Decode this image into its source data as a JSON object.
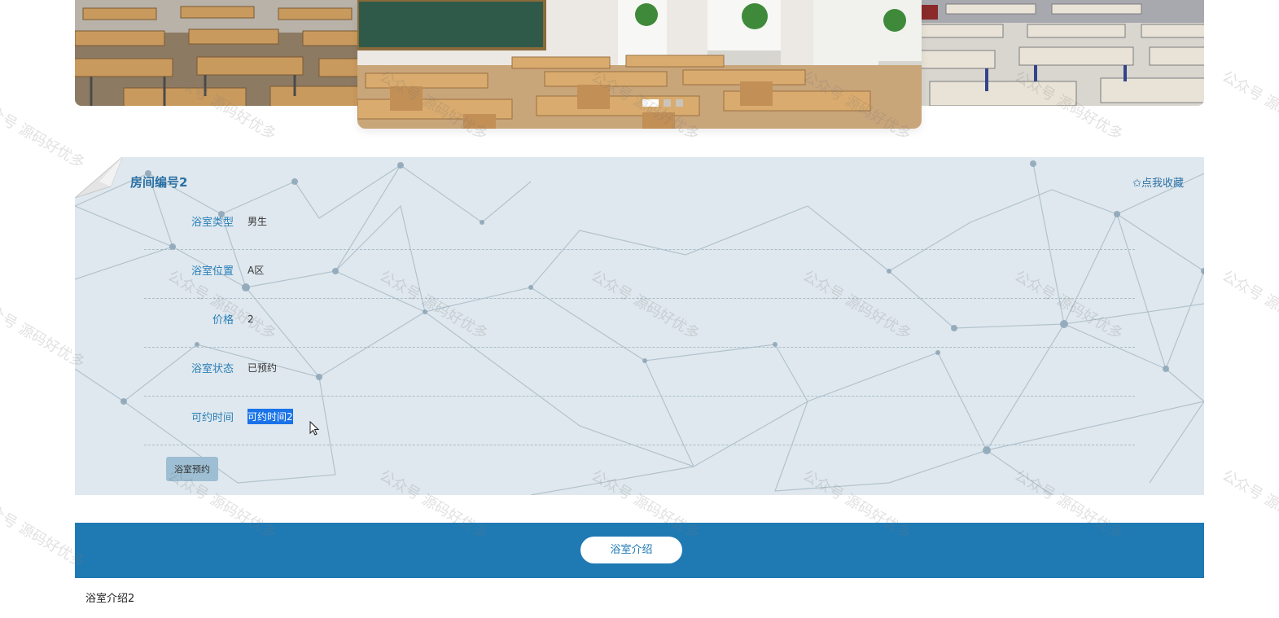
{
  "room": {
    "title": "房间编号2",
    "favorite_label": "✩点我收藏",
    "fields": [
      {
        "label": "浴室类型",
        "value": "男生"
      },
      {
        "label": "浴室位置",
        "value": "A区"
      },
      {
        "label": "价格",
        "value": "2"
      },
      {
        "label": "浴室状态",
        "value": "已预约"
      },
      {
        "label": "可约时间",
        "value": "可约时间2"
      }
    ],
    "book_button": "浴室预约"
  },
  "carousel": {
    "slide_count": 3,
    "active_index": 0
  },
  "intro": {
    "tab_label": "浴室介绍",
    "content": "浴室介绍2"
  },
  "watermark": {
    "text": "公众号 源码好优多"
  }
}
